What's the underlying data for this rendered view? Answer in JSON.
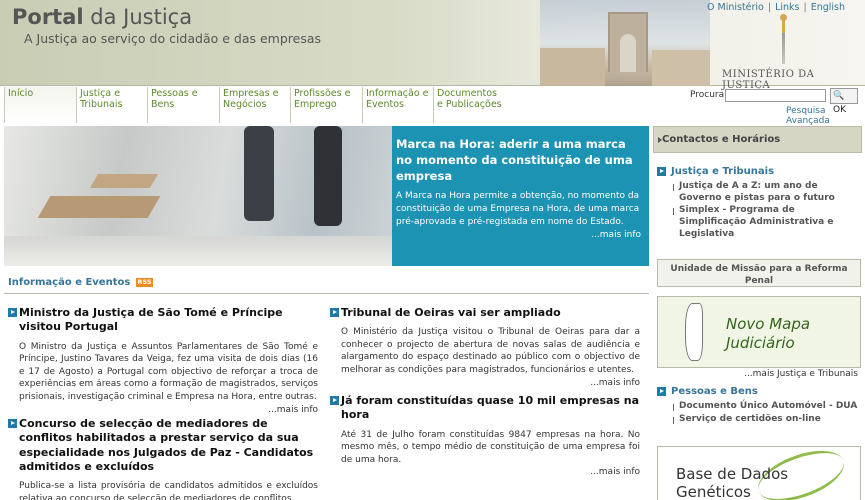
{
  "header": {
    "portal_bold": "Portal",
    "portal_rest": " da Justiça",
    "tagline": "A Justiça ao serviço do cidadão e das empresas",
    "toplinks": [
      "O Ministério",
      "Links",
      "English"
    ],
    "ministerio": "MINISTÉRIO DA JUSTIÇA"
  },
  "nav": {
    "items": [
      {
        "label": "Início"
      },
      {
        "label": "Justiça e Tribunais"
      },
      {
        "label": "Pessoas e Bens"
      },
      {
        "label": "Empresas e Negócios"
      },
      {
        "label": "Profissões e Emprego"
      },
      {
        "label": "Informação e Eventos"
      },
      {
        "label": "Documentos e Publicações"
      }
    ]
  },
  "search": {
    "label": "Procura",
    "value": "",
    "button": "OK",
    "advanced": "Pesquisa Avançada"
  },
  "banner": {
    "title": "Marca na Hora: aderir a uma marca no momento da constituição de uma empresa",
    "text": "A Marca na Hora permite a obtenção, no momento da constituição de uma Empresa na Hora, de uma marca pré-aprovada e pré-registada em nome do Estado.",
    "more": "...mais info"
  },
  "news_section": {
    "title": "Informação e Eventos",
    "rss": "RSS"
  },
  "news": [
    {
      "title": "Ministro da Justiça de São Tomé e Príncipe visitou Portugal",
      "text": "O Ministro da Justiça e Assuntos Parlamentares de São Tomé e Príncipe, Justino Tavares da Veiga, fez uma visita de dois dias (16 e 17 de Agosto) a Portugal com objectivo de reforçar a troca de experiências em áreas como a formação de magistrados, serviços prisionais, investigação criminal e Empresa na Hora, entre outras.",
      "more": "...mais info"
    },
    {
      "title": "Concurso de selecção de mediadores de conflitos habilitados a prestar serviço da sua especialidade nos Julgados de Paz - Candidatos admitidos e excluídos",
      "text": "Publica-se a lista provisória de candidatos admitidos e excluídos relativa ao concurso de selecção de mediadores de conflitos",
      "more": ""
    },
    {
      "title": "Tribunal de Oeiras vai ser ampliado",
      "text": "O Ministério da Justiça visitou o Tribunal de Oeiras para dar a conhecer o projecto de abertura de novas salas de audiência e alargamento do espaço destinado ao público com o objectivo de melhorar as condições para magistrados, funcionários e utentes.",
      "more": "...mais info"
    },
    {
      "title": "Já foram constituídas quase 10 mil empresas na hora",
      "text": "Até 31 de Julho foram constituídas 9847 empresas na hora. No mesmo mês, o tempo médio de constituição de uma empresa foi de uma hora.",
      "more": "...mais info"
    }
  ],
  "sidebar": {
    "contact": "Contactos e Horários",
    "justica": {
      "head": "Justiça e Tribunais",
      "items": [
        "Justiça de A a Z: um ano de Governo e pistas para o futuro",
        "Simplex - Programa de Simplificação Administrativa e Legislativa"
      ]
    },
    "reforma": "Unidade de Missão para a Reforma Penal",
    "mapa": "Novo Mapa Judiciário",
    "mapa_more": "...mais Justiça e Tribunais",
    "pessoas": {
      "head": "Pessoas e Bens",
      "items": [
        "Documento Único Automóvel - DUA",
        "Serviço de certidões on-line"
      ]
    },
    "bdg": "Base de Dados Genéticos"
  },
  "colors": {
    "banner_bg": "#1d93b4",
    "link_blue": "#36759a",
    "nav_green": "#5b8a2a",
    "rss_orange": "#f28a1c"
  }
}
